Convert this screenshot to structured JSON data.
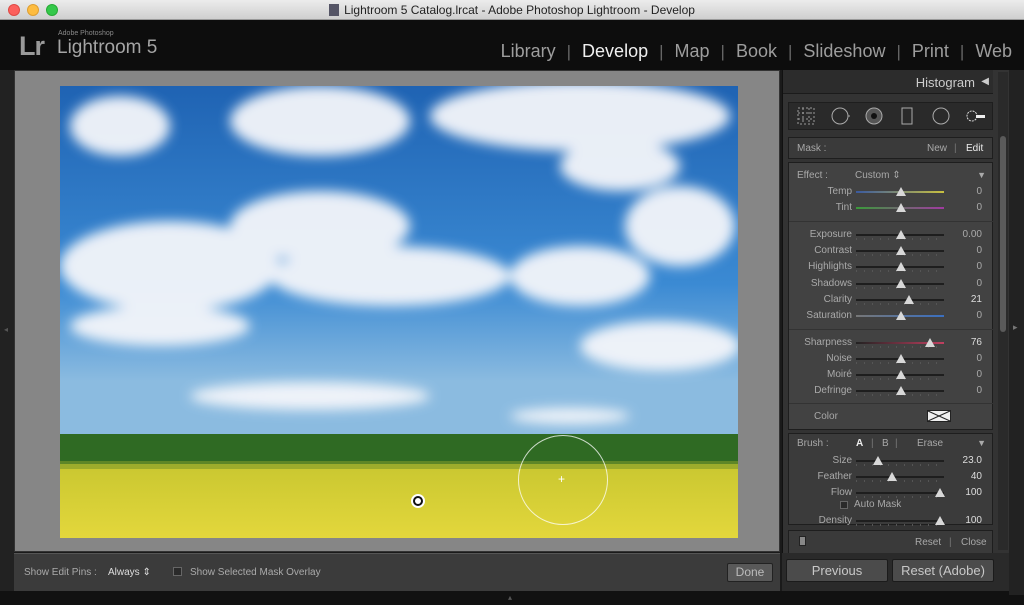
{
  "window": {
    "title": "Lightroom 5 Catalog.lrcat - Adobe Photoshop Lightroom - Develop"
  },
  "identity": {
    "logo": "Lr",
    "vendor": "Adobe Photoshop",
    "product": "Lightroom 5"
  },
  "modules": [
    "Library",
    "Develop",
    "Map",
    "Book",
    "Slideshow",
    "Print",
    "Web"
  ],
  "active_module": "Develop",
  "toolbar": {
    "show_pins_label": "Show Edit Pins :",
    "show_pins_value": "Always",
    "overlay_label": "Show Selected Mask Overlay",
    "done_label": "Done"
  },
  "panel": {
    "histogram_title": "Histogram",
    "mask": {
      "label": "Mask :",
      "new": "New",
      "edit": "Edit"
    },
    "effect": {
      "label": "Effect :",
      "value": "Custom"
    },
    "sliders_wb": [
      {
        "label": "Temp",
        "value": "0",
        "pos": 0.5
      },
      {
        "label": "Tint",
        "value": "0",
        "pos": 0.5
      }
    ],
    "sliders_tone": [
      {
        "label": "Exposure",
        "value": "0.00",
        "pos": 0.5
      },
      {
        "label": "Contrast",
        "value": "0",
        "pos": 0.5
      },
      {
        "label": "Highlights",
        "value": "0",
        "pos": 0.5
      },
      {
        "label": "Shadows",
        "value": "0",
        "pos": 0.5
      },
      {
        "label": "Clarity",
        "value": "21",
        "pos": 0.6
      },
      {
        "label": "Saturation",
        "value": "0",
        "pos": 0.5
      }
    ],
    "sliders_detail": [
      {
        "label": "Sharpness",
        "value": "76",
        "pos": 0.84
      },
      {
        "label": "Noise",
        "value": "0",
        "pos": 0.5
      },
      {
        "label": "Moiré",
        "value": "0",
        "pos": 0.5
      },
      {
        "label": "Defringe",
        "value": "0",
        "pos": 0.5
      }
    ],
    "color_label": "Color",
    "brush": {
      "label": "Brush :",
      "a": "A",
      "b": "B",
      "erase": "Erase",
      "sliders": [
        {
          "label": "Size",
          "value": "23.0",
          "pos": 0.25
        },
        {
          "label": "Feather",
          "value": "40",
          "pos": 0.4
        },
        {
          "label": "Flow",
          "value": "100",
          "pos": 1.0
        }
      ],
      "automask": "Auto Mask",
      "density": {
        "label": "Density",
        "value": "100",
        "pos": 1.0
      }
    },
    "reset": "Reset",
    "close": "Close",
    "previous": "Previous",
    "reset_adobe": "Reset (Adobe)"
  },
  "colors": {
    "accent": "#efefef",
    "panel": "#424242",
    "sky": "#2d7ac4",
    "field": "#d9d23a",
    "grass": "#2e6a22"
  }
}
